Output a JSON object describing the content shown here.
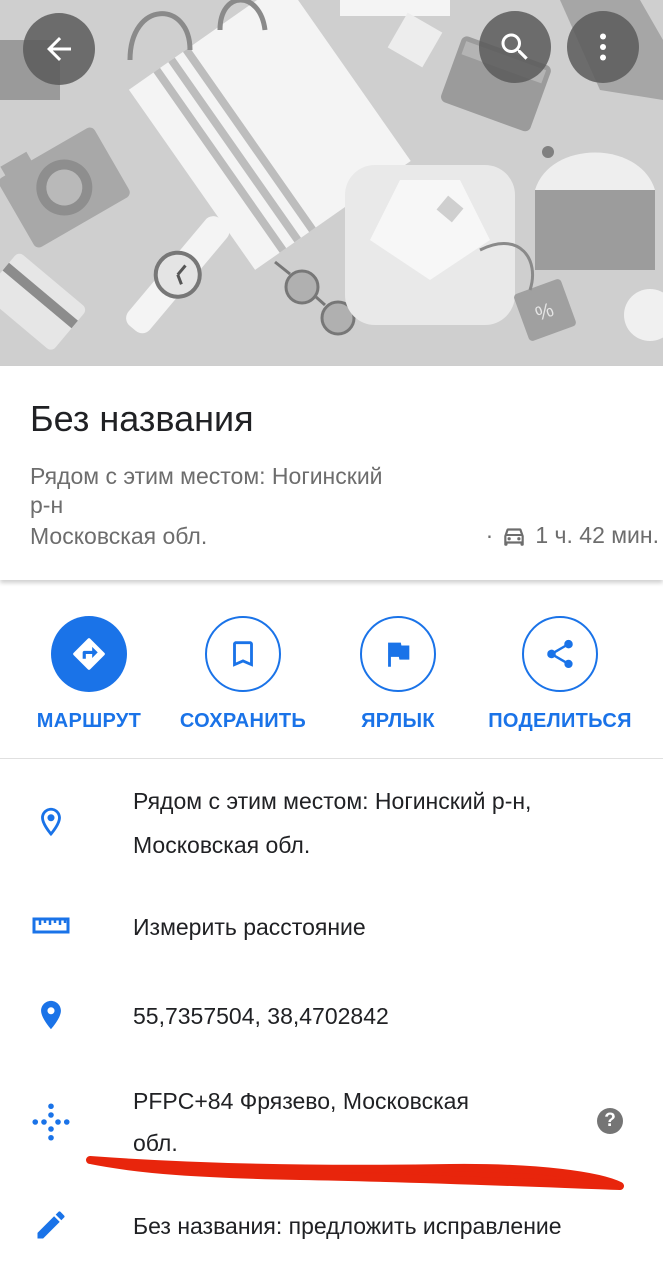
{
  "place": {
    "title": "Без названия",
    "subtitle_line1": "Рядом с этим местом: Ногинский",
    "subtitle_line2": "р-н",
    "subtitle_line3": "Московская обл.",
    "eta_separator": "·",
    "eta": "1 ч. 42 мин."
  },
  "actions": [
    {
      "label": "МАРШРУТ",
      "icon": "directions-icon"
    },
    {
      "label": "СОХРАНИТЬ",
      "icon": "bookmark-icon"
    },
    {
      "label": "ЯРЛЫК",
      "icon": "flag-icon"
    },
    {
      "label": "ПОДЕЛИТЬСЯ",
      "icon": "share-icon"
    }
  ],
  "details": {
    "address_line1": "Рядом с этим местом: Ногинский р-н,",
    "address_line2": "Московская обл.",
    "measure": "Измерить расстояние",
    "coordinates": "55,7357504, 38,4702842",
    "pluscode_line1": "PFPC+84 Фрязево, Московская",
    "pluscode_line2": "обл.",
    "help": "?",
    "suggest_edit": "Без названия: предложить исправление"
  },
  "colors": {
    "accent": "#1a73e8",
    "annotation": "#e8250c"
  }
}
